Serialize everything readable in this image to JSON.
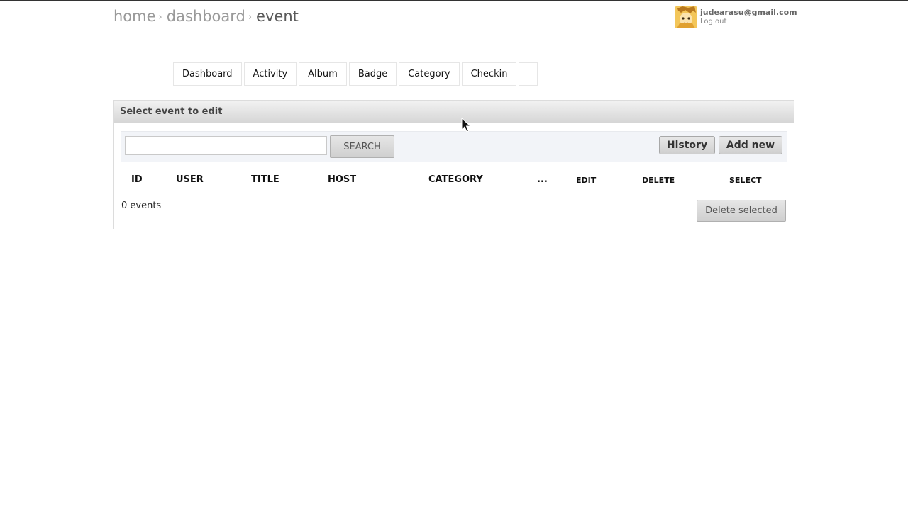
{
  "breadcrumb": {
    "home": "home",
    "dashboard": "dashboard",
    "current": "event",
    "separator": "›"
  },
  "user": {
    "email": "judearasu@gmail.com",
    "logout_label": "Log out"
  },
  "menu": {
    "items": [
      {
        "label": "Dashboard"
      },
      {
        "label": "Activity"
      },
      {
        "label": "Album"
      },
      {
        "label": "Badge"
      },
      {
        "label": "Category"
      },
      {
        "label": "Checkin"
      },
      {
        "label": ""
      }
    ]
  },
  "panel": {
    "title": "Select event to edit",
    "search": {
      "value": "",
      "button_label": "SEARCH"
    },
    "history_label": "History",
    "add_new_label": "Add new",
    "columns": [
      "ID",
      "USER",
      "TITLE",
      "HOST",
      "CATEGORY",
      "...",
      "EDIT",
      "DELETE",
      "SELECT"
    ],
    "count_text": "0 events",
    "delete_selected_label": "Delete selected"
  },
  "colors": {
    "header_gradient_top": "#f2f2f2",
    "header_gradient_bottom": "#d6d6d6",
    "toolbar_bg": "#f2f4f8"
  },
  "icons": {
    "avatar": "avatar-image",
    "cursor": "mouse-pointer-icon"
  }
}
